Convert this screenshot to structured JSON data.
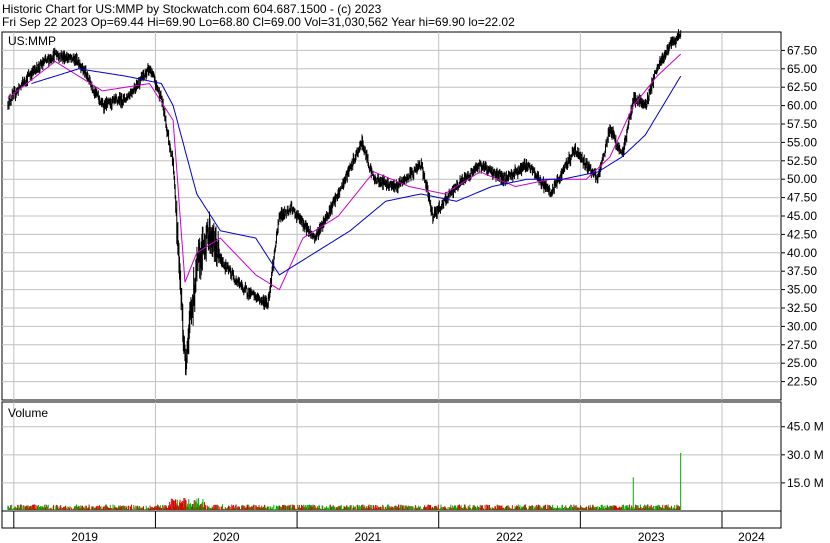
{
  "header": {
    "line1": "Historic Chart for US:MMP by Stockwatch.com 604.687.1500 - (c) 2023",
    "line2": "Fri Sep 22 2023   Op=69.44   Hi=69.90   Lo=68.80   Cl=69.00   Vol=31,030,562   Year hi=69.90   lo=22.02"
  },
  "colors": {
    "candles": "#000000",
    "ma_fast": "#cc00cc",
    "ma_slow": "#0000cc",
    "grid": "#c0c0c0",
    "volume_up": "#00aa00",
    "volume_down": "#dd0000"
  },
  "chart_data": [
    {
      "type": "line",
      "title": "",
      "symbol_label": "US:MMP",
      "ylabel": "",
      "xlabel": "",
      "ylim": [
        20.0,
        70.0
      ],
      "yticks": [
        "67.50",
        "65.00",
        "62.50",
        "60.00",
        "57.50",
        "55.00",
        "52.50",
        "50.00",
        "47.50",
        "45.00",
        "42.50",
        "40.00",
        "37.50",
        "35.00",
        "32.50",
        "30.00",
        "27.50",
        "25.00",
        "22.50"
      ],
      "x_labels": [
        "2019",
        "2020",
        "2021",
        "2022",
        "2023",
        "2024"
      ],
      "grid": true,
      "series": [
        {
          "kind": "price",
          "x": [
            "2018-12",
            "2019-02",
            "2019-04",
            "2019-06",
            "2019-08",
            "2019-10",
            "2019-12",
            "2020-01",
            "2020-02",
            "2020-03",
            "2020-04",
            "2020-05",
            "2020-06",
            "2020-08",
            "2020-10",
            "2020-11",
            "2020-12",
            "2021-02",
            "2021-04",
            "2021-06",
            "2021-07",
            "2021-09",
            "2021-11",
            "2021-12",
            "2022-02",
            "2022-04",
            "2022-06",
            "2022-08",
            "2022-10",
            "2022-12",
            "2023-01",
            "2023-02",
            "2023-03",
            "2023-04",
            "2023-05",
            "2023-06",
            "2023-07",
            "2023-08",
            "2023-09"
          ],
          "values": [
            60.5,
            64.5,
            67,
            66,
            60,
            61,
            65,
            61,
            52,
            25,
            38,
            43,
            39,
            35,
            33,
            45,
            46,
            42,
            48,
            55,
            50,
            49,
            52,
            45,
            49,
            52,
            50,
            52,
            48,
            54,
            52,
            50,
            57,
            53,
            61,
            60,
            65,
            68,
            69.5
          ]
        },
        {
          "kind": "moving_average_short",
          "x": [
            "2018-12",
            "2019-04",
            "2019-08",
            "2019-12",
            "2020-02",
            "2020-03",
            "2020-04",
            "2020-06",
            "2020-09",
            "2020-11",
            "2021-01",
            "2021-04",
            "2021-07",
            "2021-10",
            "2022-01",
            "2022-04",
            "2022-07",
            "2022-10",
            "2023-01",
            "2023-03",
            "2023-05",
            "2023-07",
            "2023-09"
          ],
          "values": [
            61,
            66,
            62,
            63,
            58,
            36,
            40,
            42,
            37,
            35,
            42,
            45,
            51,
            49,
            48,
            51,
            49,
            50,
            50,
            53,
            60,
            64,
            67
          ]
        },
        {
          "kind": "moving_average_long",
          "x": [
            "2019-02",
            "2019-06",
            "2019-10",
            "2020-01",
            "2020-02",
            "2020-04",
            "2020-06",
            "2020-09",
            "2020-11",
            "2021-02",
            "2021-05",
            "2021-08",
            "2021-11",
            "2022-02",
            "2022-05",
            "2022-08",
            "2022-11",
            "2023-02",
            "2023-04",
            "2023-06",
            "2023-09"
          ],
          "values": [
            63,
            65,
            64,
            63,
            60,
            48,
            43,
            42,
            37,
            40,
            43,
            47,
            48,
            47,
            49,
            50,
            50,
            51,
            53,
            56,
            64
          ]
        }
      ]
    },
    {
      "type": "bar",
      "title": "",
      "panel_label": "Volume",
      "yticks": [
        "45.0 M",
        "30.0 M",
        "15.0 M"
      ],
      "ylim": [
        0,
        55
      ],
      "notable_values": [
        {
          "x": "2023-05",
          "value": 18
        },
        {
          "x": "2023-09",
          "value": 31
        }
      ],
      "baseline_range": [
        0.5,
        3.5
      ]
    }
  ]
}
